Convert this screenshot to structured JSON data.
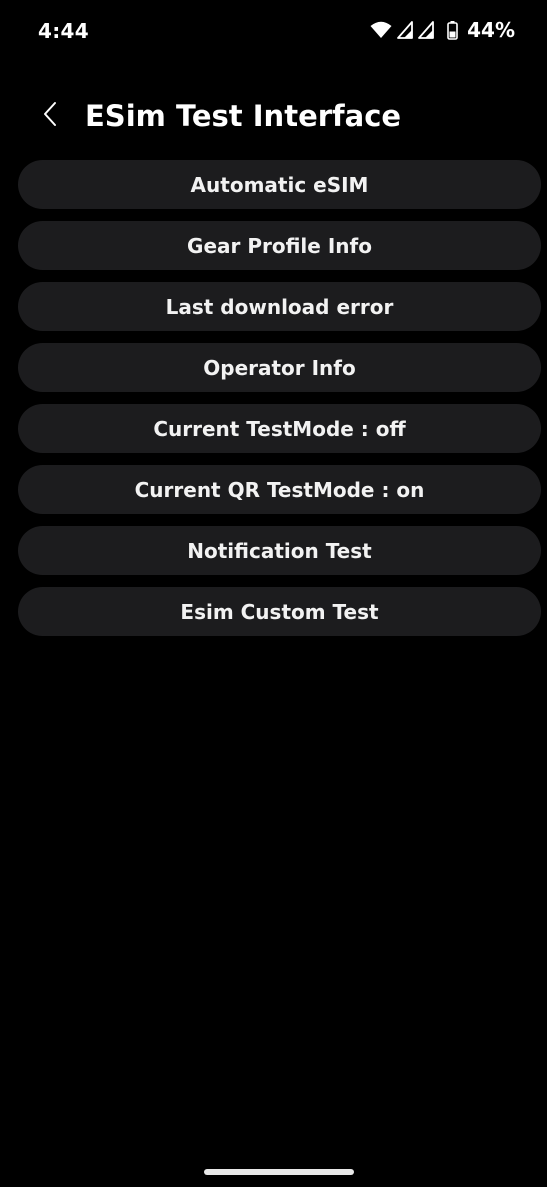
{
  "status_bar": {
    "time": "4:44",
    "battery": "44%",
    "icons": [
      "wifi-icon",
      "signal-icon",
      "signal-icon",
      "battery-icon"
    ]
  },
  "header": {
    "back_icon": "chevron-left-icon",
    "title": "ESim Test Interface"
  },
  "menu": {
    "items": [
      {
        "label": "Automatic eSIM"
      },
      {
        "label": "Gear Profile Info"
      },
      {
        "label": "Last download error"
      },
      {
        "label": "Operator Info"
      },
      {
        "label": "Current TestMode : off"
      },
      {
        "label": "Current QR TestMode : on"
      },
      {
        "label": "Notification Test"
      },
      {
        "label": "Esim Custom Test"
      }
    ]
  },
  "colors": {
    "background": "#000000",
    "item_background": "#1c1c1e",
    "text": "#ffffff"
  }
}
